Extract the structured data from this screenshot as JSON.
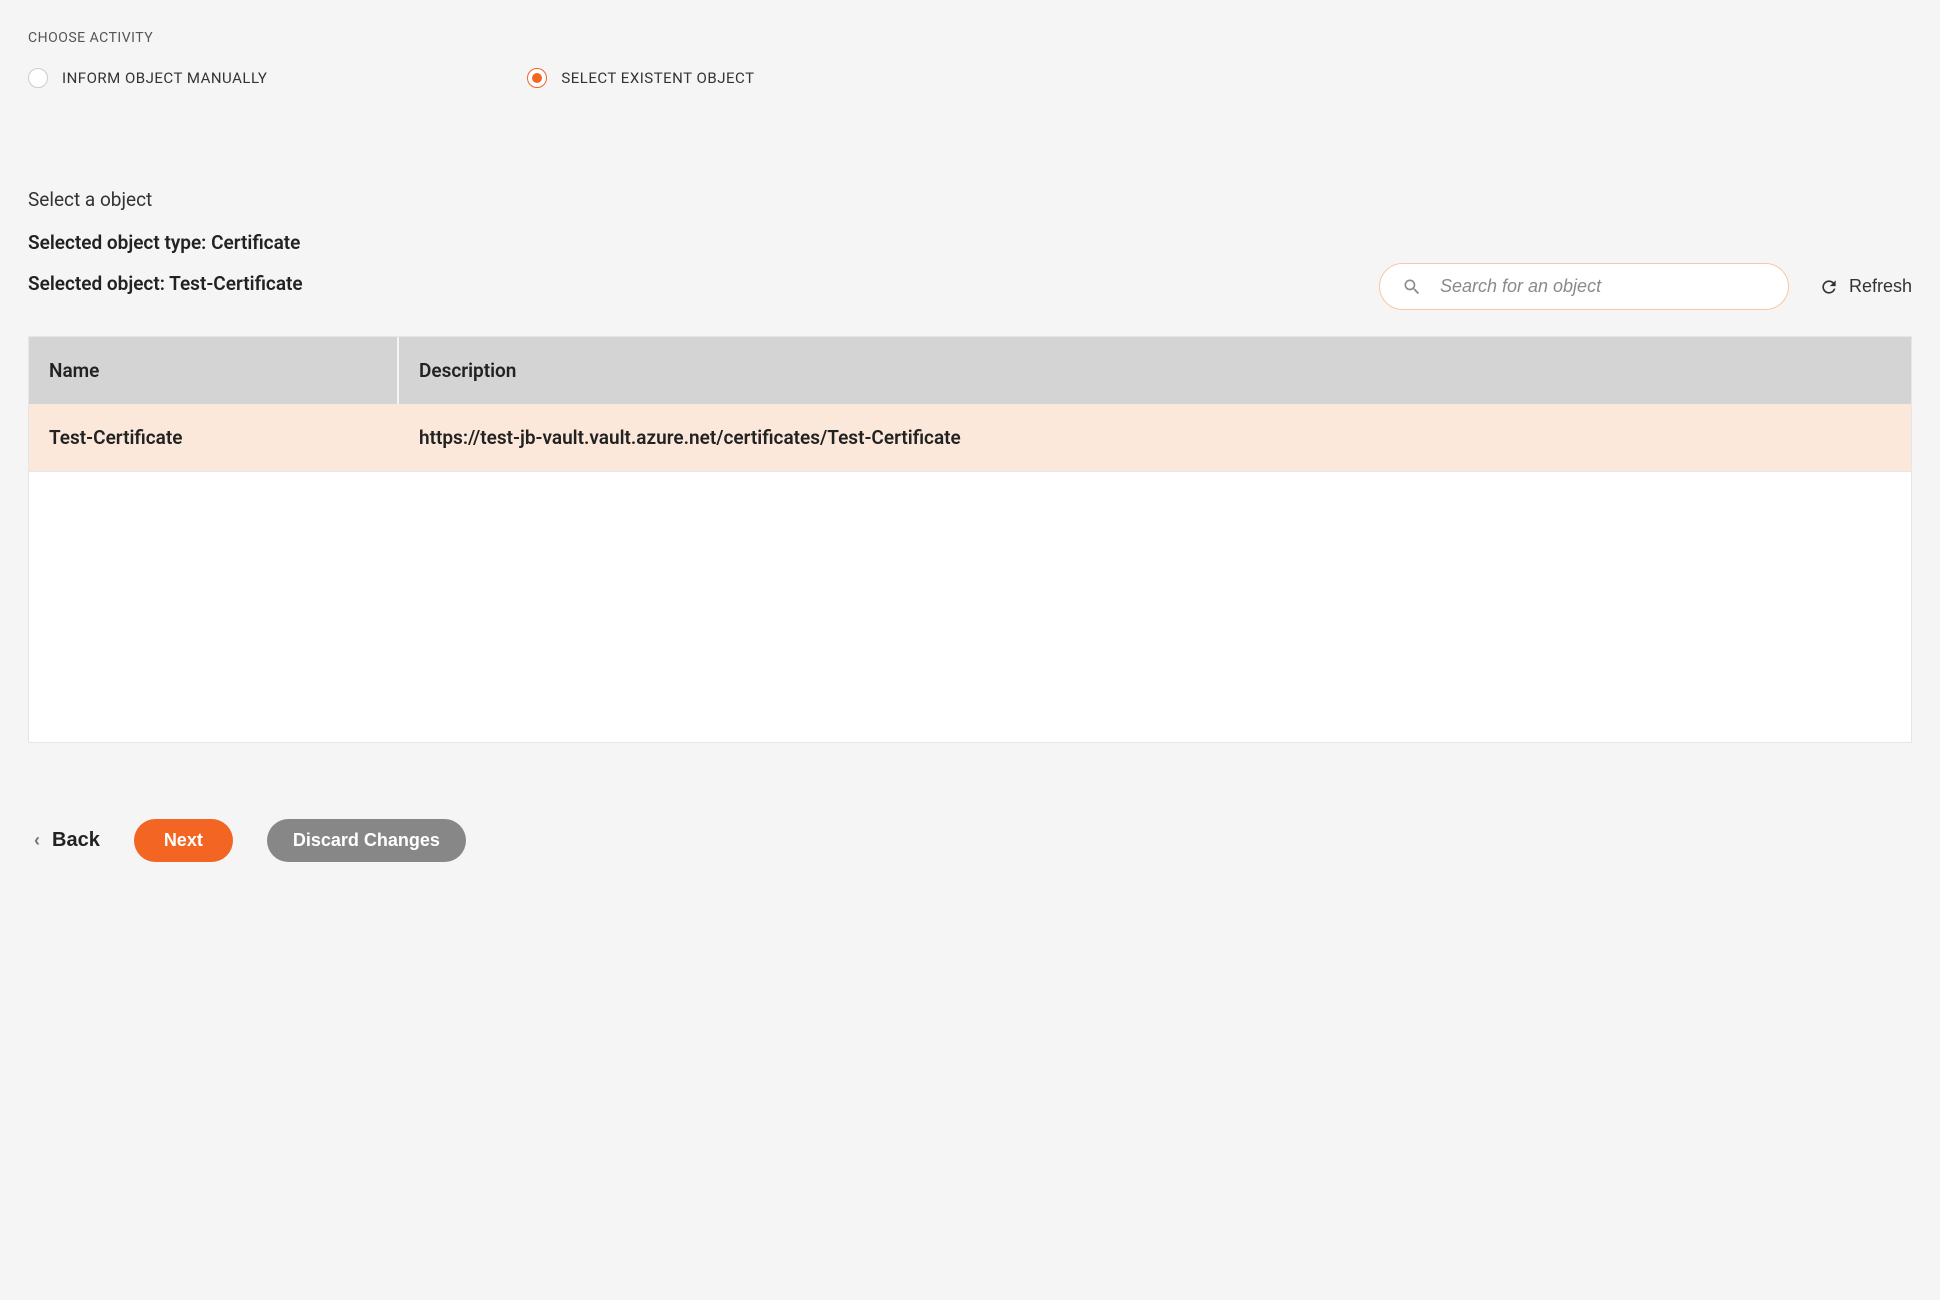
{
  "activity": {
    "label": "CHOOSE ACTIVITY",
    "options": {
      "manual": "INFORM OBJECT MANUALLY",
      "existent": "SELECT EXISTENT OBJECT"
    },
    "selected": "existent"
  },
  "object_section": {
    "heading": "Select a object",
    "type_line": "Selected object type: Certificate",
    "selected_line": "Selected object: Test-Certificate"
  },
  "search": {
    "placeholder": "Search for an object"
  },
  "refresh_label": "Refresh",
  "table": {
    "headers": {
      "name": "Name",
      "description": "Description"
    },
    "rows": [
      {
        "name": "Test-Certificate",
        "description": "https://test-jb-vault.vault.azure.net/certificates/Test-Certificate",
        "selected": true
      }
    ]
  },
  "footer": {
    "back": "Back",
    "next": "Next",
    "discard": "Discard Changes"
  }
}
